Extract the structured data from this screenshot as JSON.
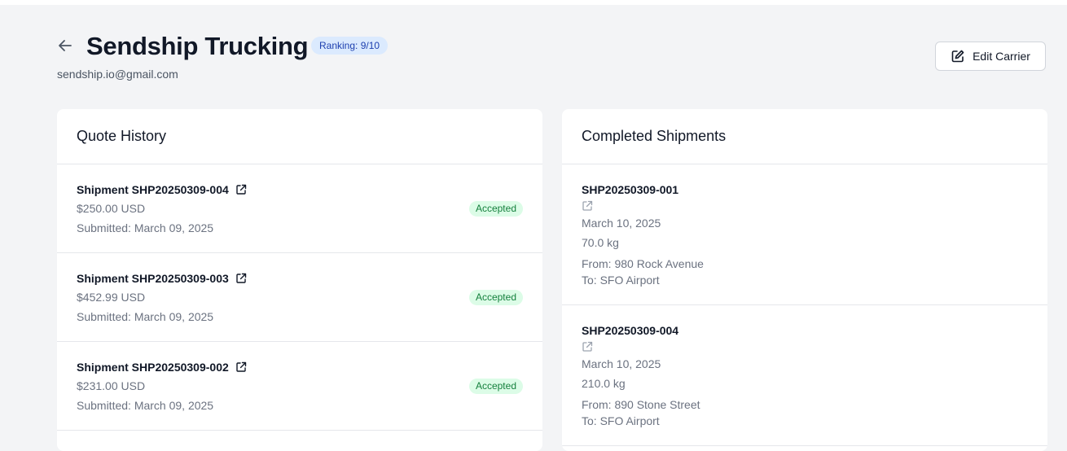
{
  "header": {
    "title": "Sendship Trucking",
    "ranking": "Ranking: 9/10",
    "email": "sendship.io@gmail.com",
    "edit_label": "Edit Carrier",
    "back_icon": "arrow-left-icon",
    "edit_icon": "edit-pencil-icon"
  },
  "quote_history": {
    "title": "Quote History",
    "items": [
      {
        "name": "Shipment SHP20250309-004",
        "amount": "$250.00 USD",
        "submitted": "Submitted: March 09, 2025",
        "status": "Accepted"
      },
      {
        "name": "Shipment SHP20250309-003",
        "amount": "$452.99 USD",
        "submitted": "Submitted: March 09, 2025",
        "status": "Accepted"
      },
      {
        "name": "Shipment SHP20250309-002",
        "amount": "$231.00 USD",
        "submitted": "Submitted: March 09, 2025",
        "status": "Accepted"
      }
    ]
  },
  "completed_shipments": {
    "title": "Completed Shipments",
    "items": [
      {
        "id": "SHP20250309-001",
        "date": "March 10, 2025",
        "weight": "70.0 kg",
        "from": "From: 980 Rock Avenue",
        "to": "To: SFO Airport"
      },
      {
        "id": "SHP20250309-004",
        "date": "March 10, 2025",
        "weight": "210.0 kg",
        "from": "From: 890 Stone Street",
        "to": "To: SFO Airport"
      }
    ]
  },
  "colors": {
    "background": "#f3f4f6",
    "rank_badge_bg": "#dbeafe",
    "rank_badge_text": "#1e40af",
    "status_bg": "#dcfce7",
    "status_text": "#15803d"
  }
}
